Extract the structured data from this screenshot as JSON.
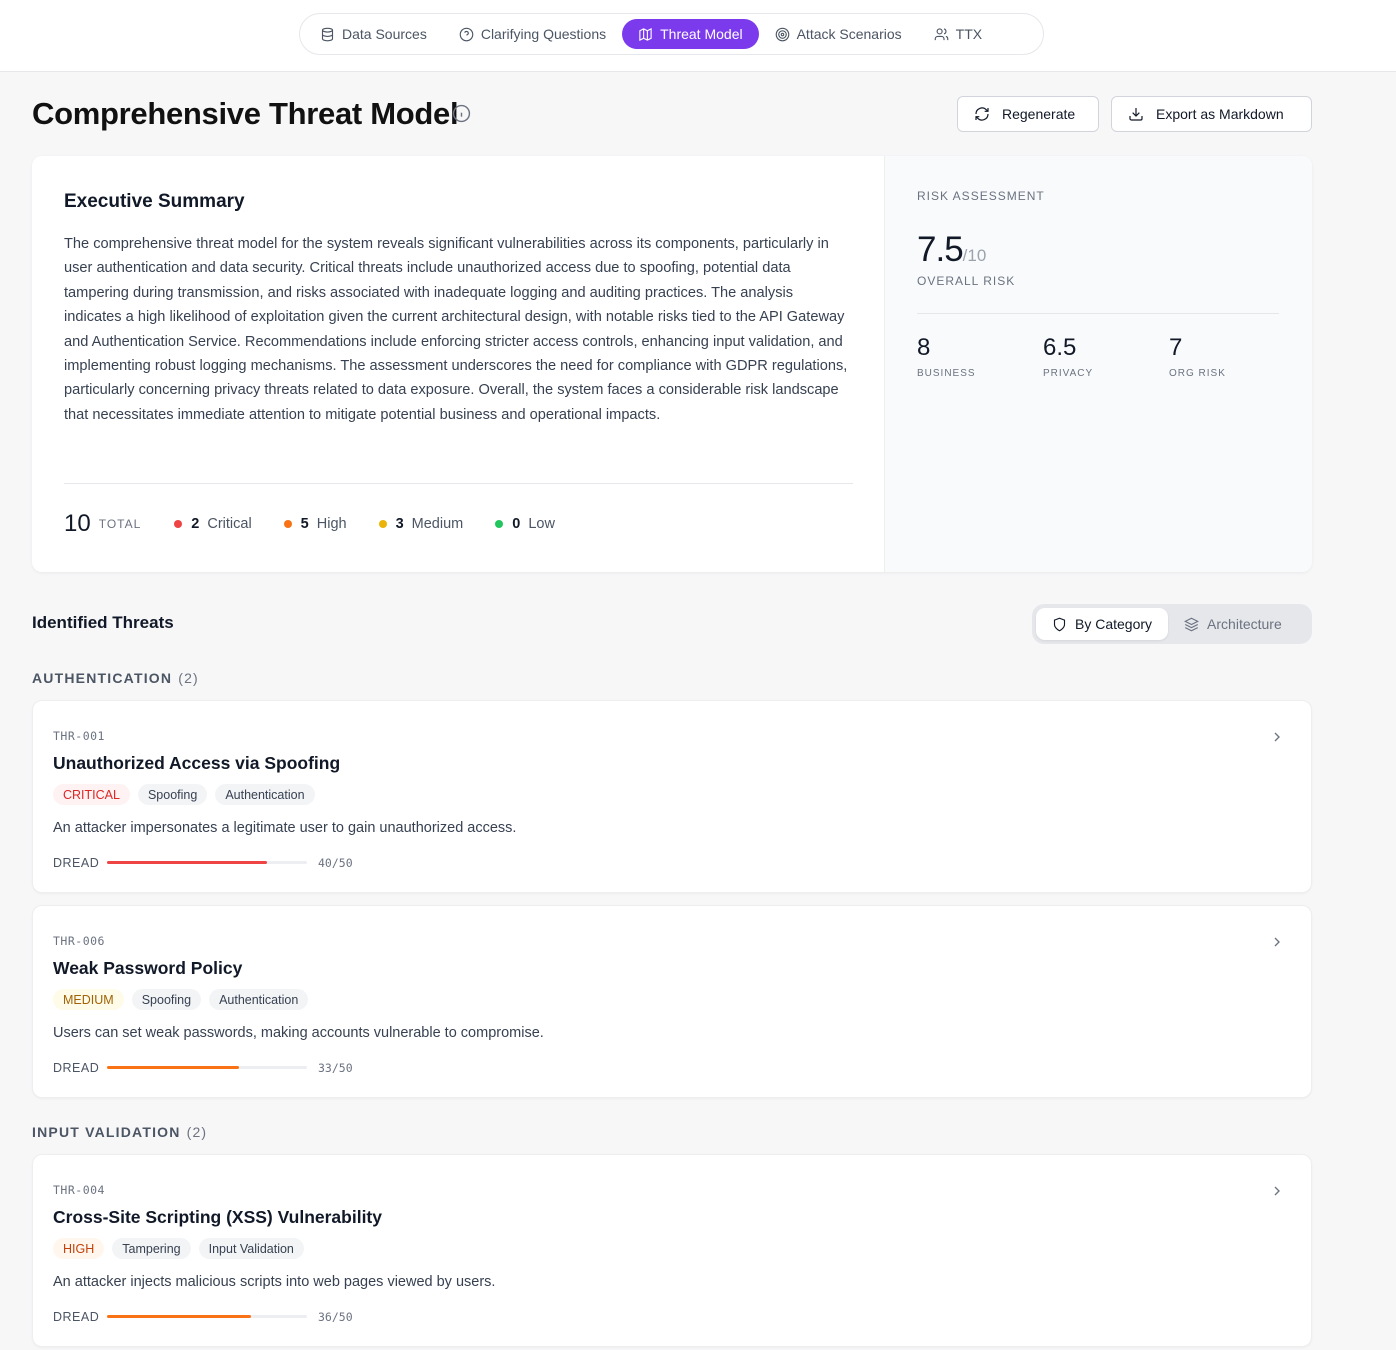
{
  "nav": {
    "tabs": [
      {
        "label": "Data Sources",
        "icon": "database-icon"
      },
      {
        "label": "Clarifying Questions",
        "icon": "help-circle-icon"
      },
      {
        "label": "Threat Model",
        "icon": "map-icon",
        "active": true
      },
      {
        "label": "Attack Scenarios",
        "icon": "target-icon"
      },
      {
        "label": "TTX",
        "icon": "users-icon"
      }
    ]
  },
  "header": {
    "title": "Comprehensive Threat Model",
    "regenerate_label": "Regenerate",
    "export_label": "Export as Markdown"
  },
  "summary": {
    "title": "Executive Summary",
    "text": "The comprehensive threat model for the system reveals significant vulnerabilities across its components, particularly in user authentication and data security. Critical threats include unauthorized access due to spoofing, potential data tampering during transmission, and risks associated with inadequate logging and auditing practices. The analysis indicates a high likelihood of exploitation given the current architectural design, with notable risks tied to the API Gateway and Authentication Service. Recommendations include enforcing stricter access controls, enhancing input validation, and implementing robust logging mechanisms. The assessment underscores the need for compliance with GDPR regulations, particularly concerning privacy threats related to data exposure. Overall, the system faces a considerable risk landscape that necessitates immediate attention to mitigate potential business and operational impacts.",
    "total": "10",
    "total_label": "TOTAL",
    "severity_counts": [
      {
        "count": "2",
        "label": "Critical",
        "color": "#ef4444"
      },
      {
        "count": "5",
        "label": "High",
        "color": "#f97316"
      },
      {
        "count": "3",
        "label": "Medium",
        "color": "#eab308"
      },
      {
        "count": "0",
        "label": "Low",
        "color": "#22c55e"
      }
    ]
  },
  "risk": {
    "label": "RISK ASSESSMENT",
    "score": "7.5",
    "score_max": "/10",
    "overall_label": "OVERALL RISK",
    "business": {
      "value": "8",
      "label": "BUSINESS"
    },
    "privacy": {
      "value": "6.5",
      "label": "PRIVACY"
    },
    "org": {
      "value": "7",
      "label": "ORG RISK"
    }
  },
  "threats_section": {
    "title": "Identified Threats",
    "toggle": {
      "by_category": "By Category",
      "architecture": "Architecture",
      "active": "by_category"
    }
  },
  "groups": [
    {
      "name": "AUTHENTICATION",
      "count": "(2)"
    },
    {
      "name": "INPUT VALIDATION",
      "count": "(2)"
    }
  ],
  "threats": [
    {
      "id": "THR-001",
      "title": "Unauthorized Access via Spoofing",
      "severity": "CRITICAL",
      "severity_class": "critical",
      "tags": [
        "Spoofing",
        "Authentication"
      ],
      "description": "An attacker impersonates a legitimate user to gain unauthorized access.",
      "dread_label": "DREAD",
      "dread_score": 40,
      "dread_max": 50,
      "dread_text": "40/50",
      "bar_color": "#ef4444"
    },
    {
      "id": "THR-006",
      "title": "Weak Password Policy",
      "severity": "MEDIUM",
      "severity_class": "medium",
      "tags": [
        "Spoofing",
        "Authentication"
      ],
      "description": "Users can set weak passwords, making accounts vulnerable to compromise.",
      "dread_label": "DREAD",
      "dread_score": 33,
      "dread_max": 50,
      "dread_text": "33/50",
      "bar_color": "#f97316"
    },
    {
      "id": "THR-004",
      "title": "Cross-Site Scripting (XSS) Vulnerability",
      "severity": "HIGH",
      "severity_class": "high",
      "tags": [
        "Tampering",
        "Input Validation"
      ],
      "description": "An attacker injects malicious scripts into web pages viewed by users.",
      "dread_label": "DREAD",
      "dread_score": 36,
      "dread_max": 50,
      "dread_text": "36/50",
      "bar_color": "#f97316"
    }
  ]
}
